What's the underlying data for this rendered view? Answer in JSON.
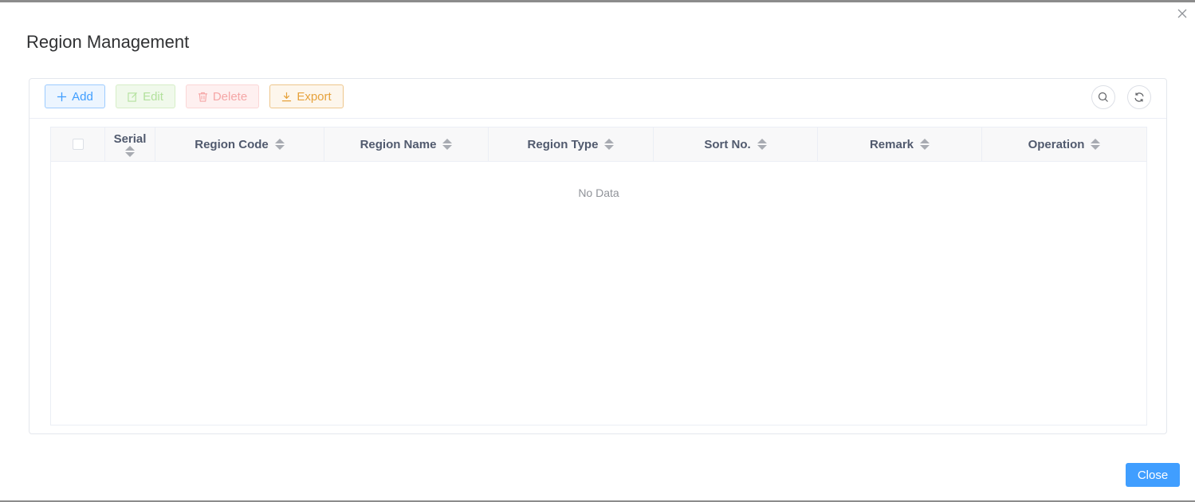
{
  "dialog": {
    "title": "Region Management",
    "close_label": "Close"
  },
  "toolbar": {
    "add_label": "Add",
    "edit_label": "Edit",
    "delete_label": "Delete",
    "export_label": "Export"
  },
  "table": {
    "columns": [
      {
        "label": "Serial"
      },
      {
        "label": "Region Code"
      },
      {
        "label": "Region Name"
      },
      {
        "label": "Region Type"
      },
      {
        "label": "Sort No."
      },
      {
        "label": "Remark"
      },
      {
        "label": "Operation"
      }
    ],
    "empty_text": "No Data"
  },
  "colors": {
    "primary": "#409eff",
    "success_light": "#b3e19d",
    "danger_light": "#f5a6a6",
    "warning": "#e6a23c"
  }
}
